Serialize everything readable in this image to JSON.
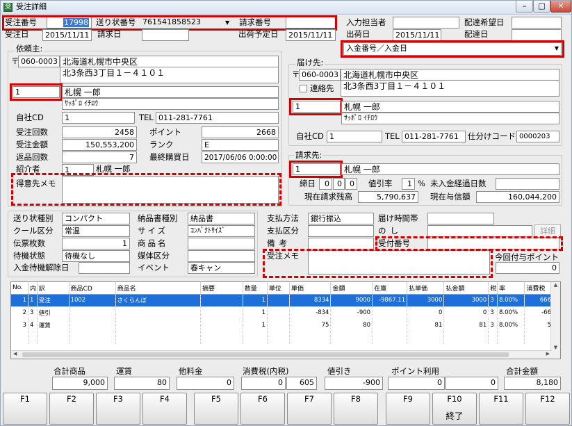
{
  "window": {
    "title": "受注詳細",
    "minimize": "–",
    "maximize": "□",
    "close": "✕"
  },
  "header": {
    "order_no_label": "受注番号",
    "order_no": "17998",
    "slip_no_label": "送り状番号",
    "slip_no": "761541858523",
    "invoice_no_label": "請求番号",
    "invoice_no": "",
    "staff_label": "入力担当者",
    "staff": "",
    "desired_date_label": "配達希望日",
    "desired_date": "",
    "order_date_label": "受注日",
    "order_date": "2015/11/11",
    "bill_date_label": "請求日",
    "bill_date": "",
    "ship_plan_label": "出荷予定日",
    "ship_plan": "2015/11/11",
    "ship_date_label": "出荷日",
    "ship_date": "2015/11/11",
    "arrive_date_label": "配達日",
    "arrive_date": ""
  },
  "payment_select": {
    "value": "入金番号／入金日"
  },
  "client": {
    "section_label": "依頼主:",
    "zip_mark": "〒",
    "zip": "060-0003",
    "address1": "北海道札幌市中央区",
    "address2": "北3条西3丁目１－４１０１",
    "code": "1",
    "name": "札幌 一郎",
    "kana": "ｻｯﾎﾟﾛ ｲﾁﾛｳ",
    "company_cd_label": "自社CD",
    "company_cd": "1",
    "tel_label": "TEL",
    "tel": "011-281-7761",
    "order_count_label": "受注回数",
    "order_count": "2458",
    "points_label": "ポイント",
    "points": "2668",
    "order_amount_label": "受注金額",
    "order_amount": "150,553,200",
    "rank_label": "ランク",
    "rank": "E",
    "return_count_label": "返品回数",
    "return_count": "7",
    "last_purchase_label": "最終購買日",
    "last_purchase": "2017/06/06 0:00:00",
    "referrer_label": "紹介者",
    "referrer_code": "1",
    "referrer_name": "札幌 一郎",
    "memo_label": "得意先メモ",
    "memo": ""
  },
  "delivery": {
    "section_label": "届け先:",
    "zip_mark": "〒",
    "zip": "060-0003",
    "address1": "北海道札幌市中央区",
    "address2": "北3条西3丁目１－４１０１",
    "contact_label": "連絡先",
    "code": "1",
    "name": "札幌 一郎",
    "kana": "ｻｯﾎﾟﾛ ｲﾁﾛｳ",
    "company_cd_label": "自社CD",
    "company_cd": "1",
    "tel_label": "TEL",
    "tel": "011-281-7761",
    "sort_code_label": "仕分けコード",
    "sort_code": "0000203"
  },
  "billing": {
    "section_label": "請求先:",
    "code": "1",
    "name": "札幌 一郎",
    "cutoff_label": "締日",
    "cutoff1": "0",
    "cutoff2": "0",
    "cutoff3": "0",
    "discount_label": "値引率",
    "discount": "1",
    "pct": "%",
    "unpaid_days_label": "未入金経過日数",
    "unpaid_days": "",
    "balance_label": "現在請求残高",
    "balance": "5,790,637",
    "credit_label": "現在与信額",
    "credit": "160,044,200"
  },
  "shipping": {
    "type_label": "送り状種別",
    "type": "コンパクト",
    "cool_label": "クール区分",
    "cool": "常温",
    "slips_label": "伝票枚数",
    "slips": "1",
    "wait_label": "待機状態",
    "wait": "待機なし",
    "release_label": "入金待機解除日",
    "release": "",
    "delivery_note_label": "納品書種別",
    "delivery_note": "納品書",
    "size_label": "サイズ",
    "size": "ｺﾝﾊﾟｸﾄｻｲｽﾞ",
    "product_name_label": "商品名",
    "product_name": "",
    "media_label": "媒体区分",
    "media": "",
    "event_label": "イベント",
    "event": "春キャン"
  },
  "payment": {
    "method_label": "支払方法",
    "method": "銀行振込",
    "time_label": "届け時間帯",
    "time": "",
    "category_label": "支払区分",
    "category": "",
    "noshi_label": "のし",
    "noshi": "",
    "detail_button": "詳細",
    "remarks_label": "備考",
    "remarks": "",
    "receipt_label": "受付番号",
    "receipt": "",
    "memo_label": "受注メモ",
    "memo": "",
    "grant_label": "今回付与ポイント",
    "grant": "0"
  },
  "grid": {
    "headers": [
      "No.",
      "内",
      "訳",
      "商品CD",
      "商品名",
      "摘要",
      "数量",
      "単位",
      "単価",
      "金額",
      "在庫",
      "払単価",
      "払金額",
      "税",
      "率",
      "消費税"
    ],
    "rows": [
      [
        "1",
        "1",
        "受注",
        "1002",
        "さくらんぼ",
        "",
        "1",
        "",
        "8334",
        "9000",
        "-9867.11",
        "3000",
        "3000",
        "3",
        "8.00%",
        "666"
      ],
      [
        "2",
        "3",
        "値引",
        "",
        "",
        "",
        "1",
        "",
        "-834",
        "-900",
        "",
        "0",
        "0",
        "3",
        "8.00%",
        "-66"
      ],
      [
        "3",
        "4",
        "運賃",
        "",
        "",
        "",
        "1",
        "",
        "75",
        "80",
        "",
        "81",
        "81",
        "3",
        "8.00%",
        "5"
      ]
    ]
  },
  "totals": {
    "items_label": "合計商品",
    "items": "9,000",
    "freight_label": "運賃",
    "freight": "80",
    "other_label": "他料金",
    "other": "0",
    "tax_label": "消費税(内税)",
    "tax1": "0",
    "tax2": "605",
    "discount_label": "値引き",
    "discount": "-900",
    "points_label": "ポイント利用",
    "points1": "0",
    "points2": "0",
    "total_label": "合計金額",
    "total": "8,180"
  },
  "fkeys": [
    {
      "key": "F1",
      "action": ""
    },
    {
      "key": "F2",
      "action": ""
    },
    {
      "key": "F3",
      "action": ""
    },
    {
      "key": "F4",
      "action": ""
    },
    {
      "key": "F5",
      "action": ""
    },
    {
      "key": "F6",
      "action": ""
    },
    {
      "key": "F7",
      "action": ""
    },
    {
      "key": "F8",
      "action": ""
    },
    {
      "key": "F9",
      "action": ""
    },
    {
      "key": "F10",
      "action": "終了"
    },
    {
      "key": "F11",
      "action": ""
    },
    {
      "key": "F12",
      "action": ""
    }
  ],
  "colors": {
    "selection": "#1e6fd9",
    "highlight_red": "#d40000",
    "window_bg": "#ececec"
  }
}
